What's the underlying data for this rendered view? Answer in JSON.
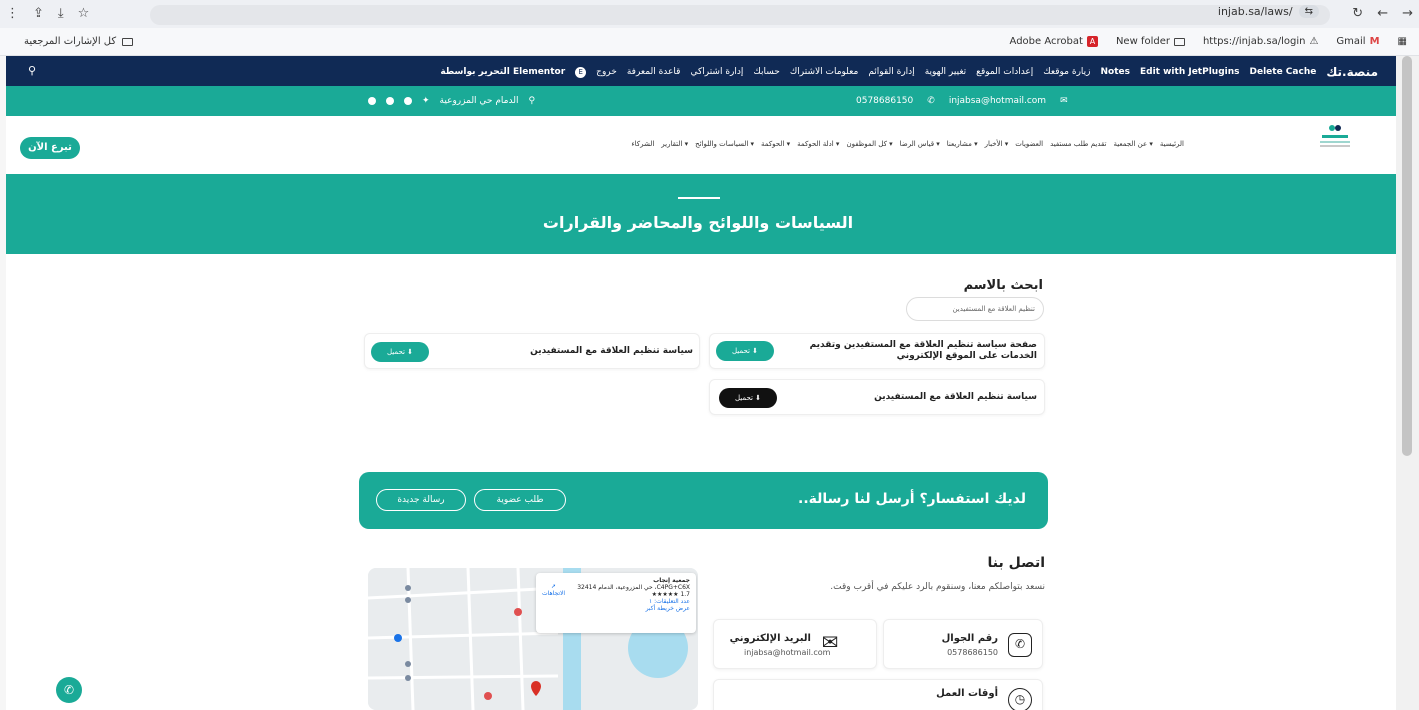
{
  "browser": {
    "url": "injab.sa/laws/",
    "bookmarks_left": "كل الإشارات المرجعية",
    "bookmarks_right": [
      "Adobe Acrobat",
      "New folder",
      "https://injab.sa/login",
      "Gmail"
    ],
    "nav_icons": [
      "↻",
      "←",
      "→"
    ]
  },
  "adminbar": {
    "brand": "منصة.تك",
    "items": [
      "Delete Cache",
      "Edit with JetPlugins",
      "Notes",
      "زيارة موقعك",
      "إعدادات الموقع",
      "تغيير الهوية",
      "إدارة القوائم",
      "معلومات الاشتراك",
      "حسابك",
      "إدارة اشتراكي",
      "قاعدة المعرفة",
      "خروج",
      "التحرير بواسطة Elementor"
    ]
  },
  "infobar": {
    "location": "الدمام حي المزروعية",
    "phone": "0578686150",
    "email": "injabsa@hotmail.com"
  },
  "nav": {
    "donate": "تبرع الآن",
    "links": [
      "الرئيسية",
      "عن الجمعية ▾",
      "تقديم طلب مستفيد",
      "العضويات",
      "الأخبار ▾",
      "مشاريعنا ▾",
      "قياس الرضا ▾",
      "كل الموظفون ▾",
      "ادلة الحوكمة ▾",
      "الحوكمة ▾",
      "السياسات واللوائح ▾",
      "التقارير ▾",
      "الشركاء"
    ]
  },
  "hero": {
    "title": "السياسات واللوائح والمحاضر والقرارات"
  },
  "search": {
    "label": "ابحث بالاسم",
    "value": "تنظيم العلاقة مع المستفيدين"
  },
  "documents": [
    {
      "title": "صفحة سياسة تنظيم العلاقة مع المستفيدين وتقديم الخدمات على الموقع الإلكتروني",
      "button": "تحميل ⬇"
    },
    {
      "title": "سياسة تنظيم العلاقة مع المستفيدين",
      "button": "تحميل ⬇"
    },
    {
      "title": "سياسة تنظيم العلاقة مع المستفيدين",
      "button": "تحميل ⬇"
    }
  ],
  "cta": {
    "title": "لديك استفسار؟ أرسل لنا رسالة..",
    "membership": "طلب عضوية",
    "new_message": "رسالة جديدة"
  },
  "contact": {
    "title": "اتصل بنا",
    "subtitle": "نسعد بتواصلكم معنا، وسنقوم بالرد عليكم في أقرب وقت.",
    "phone_label": "رقم الجوال",
    "phone_value": "0578686150",
    "email_label": "البريد الإلكتروني",
    "email_value": "injabsa@hotmail.com",
    "hours_label": "أوقات العمل"
  },
  "map": {
    "place": "جمعية إنجاب",
    "address": "C4PG+C6X، حي المزروعية، الدمام 32414",
    "rating": "1.7 ★★★★★",
    "reviews": "عدد التعليقات: ١",
    "larger": "عرض خريطة أكبر",
    "directions": "الاتجاهات"
  },
  "colors": {
    "teal": "#1aaa97",
    "navy": "#102a55"
  }
}
